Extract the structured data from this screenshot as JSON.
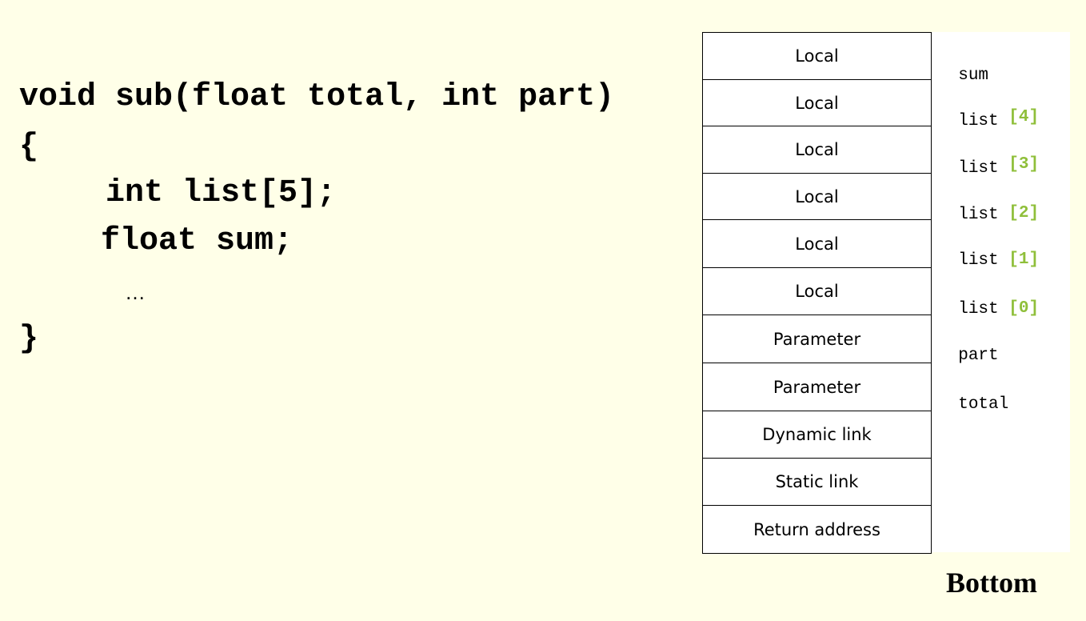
{
  "code": {
    "line1": "void sub(float total, int part)",
    "line2": "{",
    "line3": "int list[5];",
    "line4": "float sum;",
    "line5": "…",
    "line6": "}"
  },
  "stack": {
    "cells": [
      "Local",
      "Local",
      "Local",
      "Local",
      "Local",
      "Local",
      "Parameter",
      "Parameter",
      "Dynamic link",
      "Static link",
      "Return address"
    ],
    "labels": [
      {
        "name": "sum",
        "index": ""
      },
      {
        "name": "list",
        "index": "[4]"
      },
      {
        "name": "list",
        "index": "[3]"
      },
      {
        "name": "list",
        "index": "[2]"
      },
      {
        "name": "list",
        "index": "[1]"
      },
      {
        "name": "list",
        "index": "[0]"
      },
      {
        "name": "part",
        "index": ""
      },
      {
        "name": "total",
        "index": ""
      }
    ]
  },
  "bottom_label": "Bottom",
  "colors": {
    "background": "#ffffe8",
    "index_green": "#8fbf3a"
  }
}
